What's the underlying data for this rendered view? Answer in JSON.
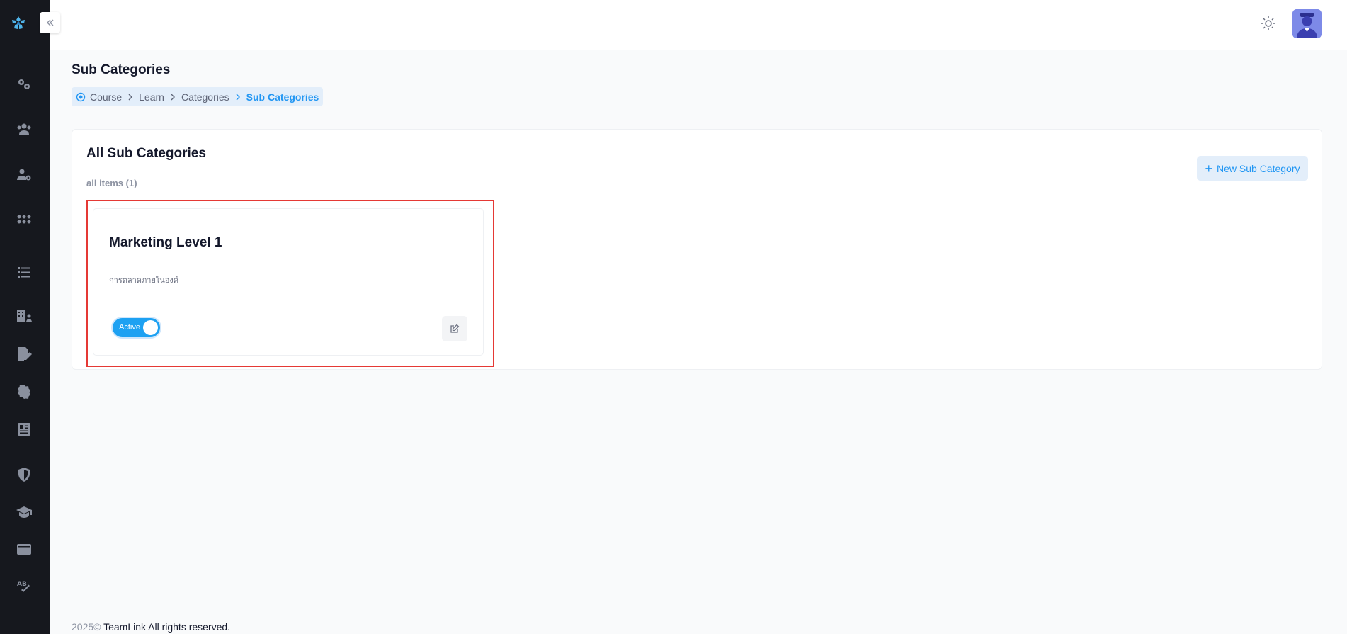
{
  "page": {
    "title": "Sub Categories"
  },
  "breadcrumb": {
    "items": [
      "Course",
      "Learn",
      "Categories",
      "Sub Categories"
    ]
  },
  "card": {
    "title": "All Sub Categories",
    "count_label": "all items (1)",
    "new_button_label": "New Sub Category"
  },
  "subcategory": {
    "name": "Marketing Level 1",
    "description": "การตลาดภายในองค์",
    "status_label": "Active",
    "active": true
  },
  "footer": {
    "year": "2025©",
    "text": " TeamLink All rights reserved."
  },
  "sidebar": {
    "icons": [
      "settings-icon",
      "users-icon",
      "user-settings-icon",
      "apps-icon",
      "list-icon",
      "building-user-icon",
      "file-signature-icon",
      "badge-icon",
      "newspaper-icon",
      "shield-icon",
      "graduation-cap-icon",
      "wallet-icon",
      "spellcheck-icon"
    ]
  },
  "colors": {
    "accent": "#2196f3",
    "sidebar": "#16181e",
    "highlight": "#e53935"
  }
}
